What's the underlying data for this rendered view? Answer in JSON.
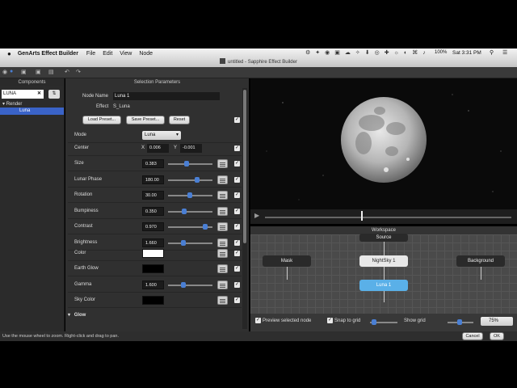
{
  "menubar": {
    "app_name": "GenArts Effect Builder",
    "items": [
      "File",
      "Edit",
      "View",
      "Node"
    ],
    "clock": "Sat 3:31 PM",
    "battery": "100%"
  },
  "window": {
    "title": "untitled - Sapphire Effect Builder"
  },
  "components": {
    "header": "Components",
    "search_value": "LUNA",
    "tree": {
      "group": "Render",
      "item": "Luna"
    }
  },
  "params": {
    "header": "Selection Parameters",
    "node_name_label": "Node Name",
    "node_name_value": "Luna 1",
    "effect_label": "Effect",
    "effect_value": "S_Luna",
    "buttons": {
      "load": "Load Preset...",
      "save": "Save Preset...",
      "reset": "Reset"
    },
    "mode_label": "Mode",
    "mode_value": "Luna",
    "center_label": "Center",
    "center_x_label": "X",
    "center_x": "0.006",
    "center_y_label": "Y",
    "center_y": "-0.001",
    "rows": [
      {
        "label": "Size",
        "value": "0.383",
        "slider": 0.4
      },
      {
        "label": "Lunar Phase",
        "value": "180.00",
        "slider": 0.68
      },
      {
        "label": "Rotation",
        "value": "30.00",
        "slider": 0.48
      },
      {
        "label": "Bumpiness",
        "value": "0.350",
        "slider": 0.35
      },
      {
        "label": "Contrast",
        "value": "0.970",
        "slider": 0.88
      },
      {
        "label": "Brightness",
        "value": "1.660",
        "slider": 0.33
      }
    ],
    "color_rows": [
      {
        "label": "Color",
        "color": "#ffffff"
      },
      {
        "label": "Earth Glow",
        "color": "#000000"
      }
    ],
    "gamma_label": "Gamma",
    "gamma_value": "1.600",
    "gamma_slider": 0.32,
    "sky_color_label": "Sky Color",
    "sky_color": "#000000",
    "glow_label": "Glow"
  },
  "workspace": {
    "header": "Workspace",
    "nodes": {
      "source": "Source",
      "mask": "Mask",
      "nightsky": "NightSky 1",
      "background": "Background",
      "luna": "Luna 1"
    },
    "preview_label": "Preview selected node",
    "snap_label": "Snap to grid",
    "show_grid_label": "Show grid",
    "zoom": "75%"
  },
  "footer": {
    "status": "Use the mouse wheel to zoom.  Right-click and drag to pan.",
    "cancel": "Cancel",
    "ok": "OK"
  },
  "colors": {
    "accent": "#4a7fd4",
    "selection": "#3a63c8"
  }
}
